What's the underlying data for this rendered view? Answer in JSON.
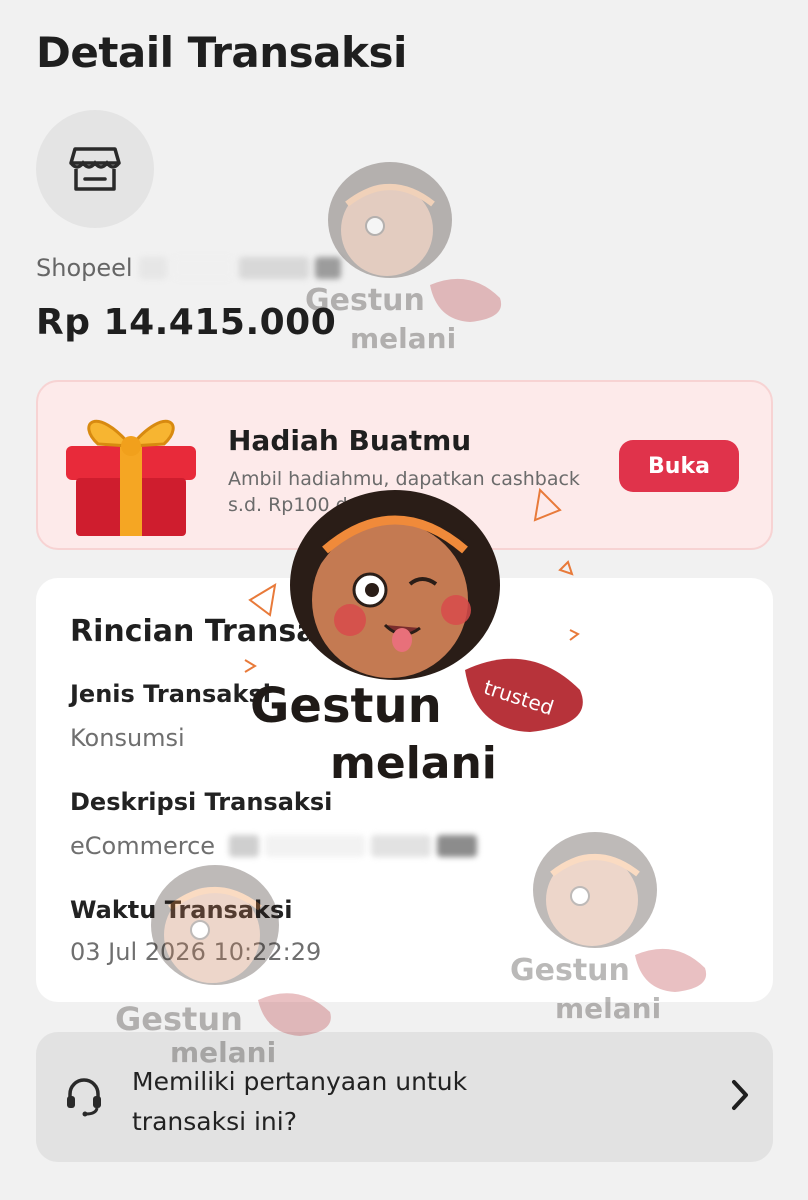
{
  "header": {
    "title": "Detail Transaksi"
  },
  "merchant": {
    "icon": "store-icon",
    "name": "Shopeel"
  },
  "transaction": {
    "amount": "Rp 14.415.000"
  },
  "promo": {
    "icon": "gift-icon",
    "title": "Hadiah Buatmu",
    "desc_line1": "Ambil hadiahmu, dapatkan cashback",
    "desc_line2": "s.d. Rp100 dan lainnya",
    "button_label": "Buka",
    "accent": "#e0334b"
  },
  "details": {
    "heading": "Rincian Transaksi",
    "items": [
      {
        "label": "Jenis Transaksi",
        "value": "Konsumsi"
      },
      {
        "label": "Deskripsi Transaksi",
        "value": "eCommerce"
      },
      {
        "label": "Waktu Transaksi",
        "value": "03 Jul 2026 10:22:29"
      }
    ]
  },
  "help": {
    "icon": "headset-icon",
    "line1": "Memiliki pertanyaan untuk",
    "line2": "transaksi ini?",
    "chevron": "chevron-right-icon"
  },
  "watermark": {
    "line1": "Gestun",
    "line2": "melani",
    "badge": "trusted"
  }
}
